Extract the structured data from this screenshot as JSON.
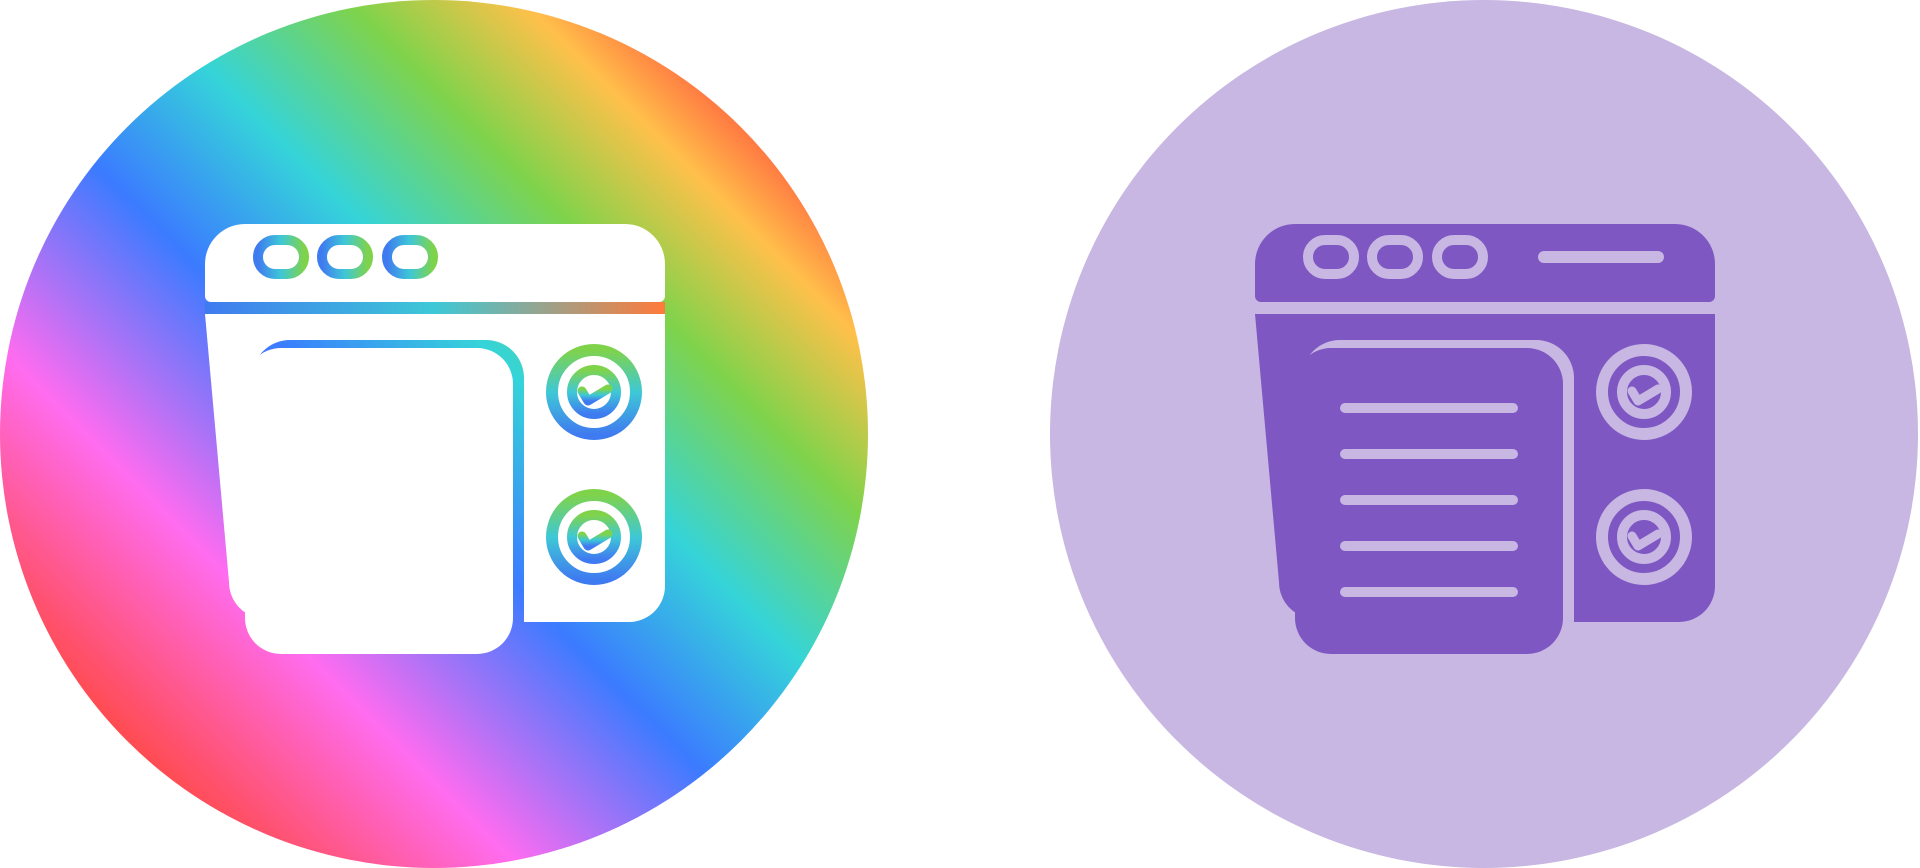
{
  "icons": [
    {
      "name": "web-page-checklist-icon",
      "style": "gradient-line",
      "background": {
        "shape": "circle",
        "gradient_stops": [
          "#a24bd6",
          "#ff4a4a",
          "#ff6cf0",
          "#3b7bff",
          "#35d4d9",
          "#7fd34b",
          "#ffc04a",
          "#ff3b3b",
          "#ffffff"
        ]
      },
      "stroke_gradient": [
        "#3f7bf0",
        "#3ec8d6",
        "#7fd34b",
        "#b14af0"
      ],
      "foreground": "#ffffff"
    },
    {
      "name": "web-page-checklist-icon",
      "style": "glyph",
      "background": {
        "shape": "circle",
        "color": "#c7b7e2"
      },
      "foreground": "#7e57c2",
      "detail": "#c7b7e2"
    }
  ]
}
